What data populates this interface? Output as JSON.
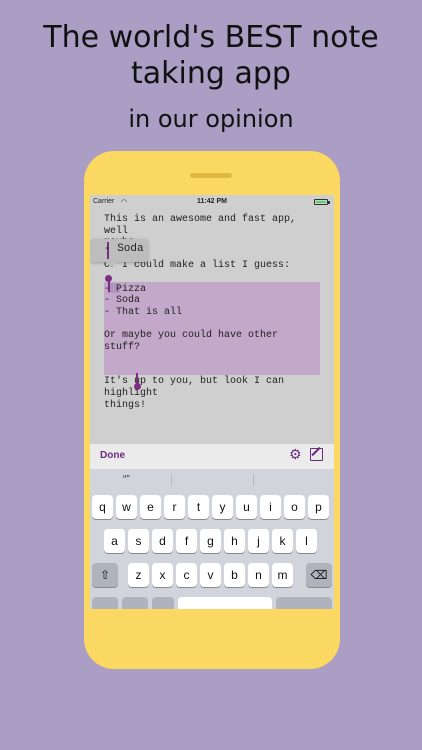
{
  "promo": {
    "headline_line1": "The world's BEST note",
    "headline_line2": "taking app",
    "subheadline": "in our opinion"
  },
  "status_bar": {
    "carrier": "Carrier",
    "time": "11:42 PM"
  },
  "note": {
    "lines": [
      "This is an awesome and fast app, well",
      "maybe.",
      "",
      "Or I could make a list I guess:",
      "",
      "- Pizza",
      "- Soda",
      "- That is all",
      "",
      "Or maybe you could have other stuff?",
      "",
      "",
      "It's up to you, but look I can highlight",
      "things!"
    ]
  },
  "loupe": {
    "text": "- Soda"
  },
  "toolbar": {
    "done_label": "Done"
  },
  "keyboard": {
    "suggestions": [
      "“”",
      "",
      ""
    ],
    "row1": [
      "q",
      "w",
      "e",
      "r",
      "t",
      "y",
      "u",
      "i",
      "o",
      "p"
    ],
    "row2": [
      "a",
      "s",
      "d",
      "f",
      "g",
      "h",
      "j",
      "k",
      "l"
    ],
    "row3": [
      "z",
      "x",
      "c",
      "v",
      "b",
      "n",
      "m"
    ]
  },
  "colors": {
    "background": "#ab9ec5",
    "phone": "#fbd862",
    "accent": "#6b2b7e",
    "highlight": "#c4a8c9"
  }
}
